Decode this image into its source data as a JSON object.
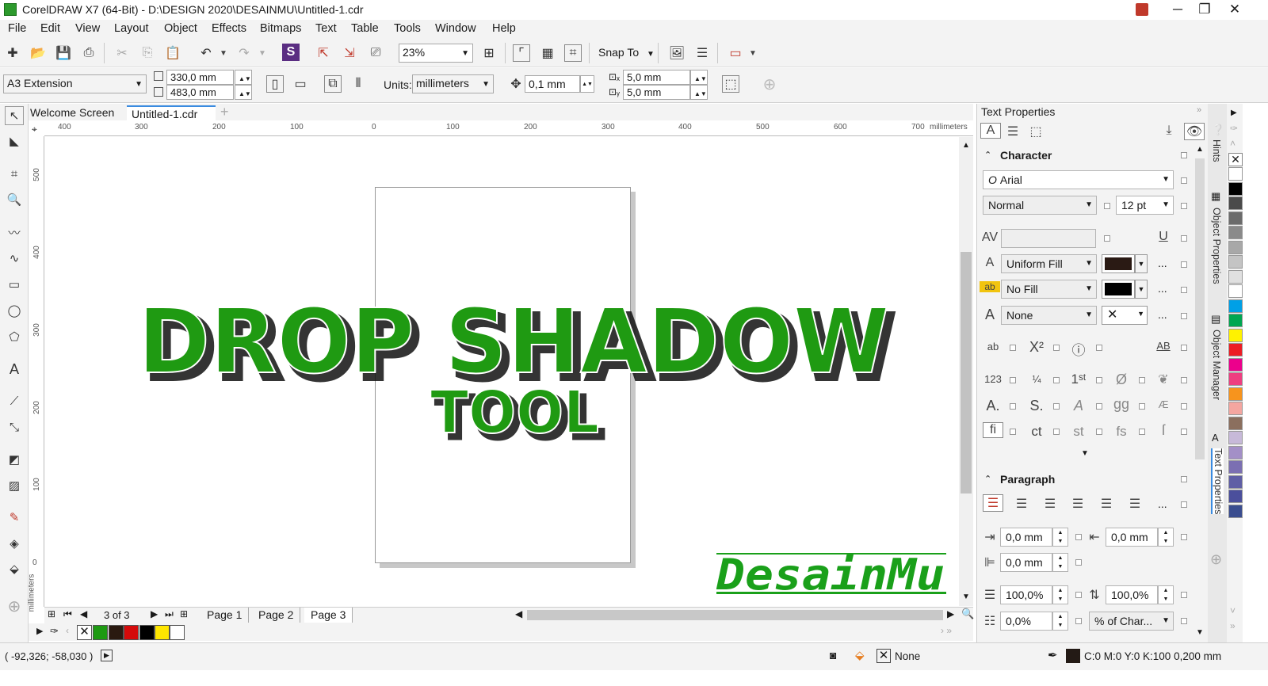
{
  "window": {
    "title": "CorelDRAW X7 (64-Bit) - D:\\DESIGN 2020\\DESAINMU\\Untitled-1.cdr",
    "minimize": "─",
    "restore": "❐",
    "close": "✕"
  },
  "menu": [
    "File",
    "Edit",
    "View",
    "Layout",
    "Object",
    "Effects",
    "Bitmaps",
    "Text",
    "Table",
    "Tools",
    "Window",
    "Help"
  ],
  "toolbar": {
    "zoom": "23%",
    "snap_to": "Snap To"
  },
  "property_bar": {
    "page_size": "A3 Extension",
    "width": "330,0 mm",
    "height": "483,0 mm",
    "units_label": "Units:",
    "units": "millimeters",
    "nudge": "0,1 mm",
    "dup_x": "5,0 mm",
    "dup_y": "5,0 mm"
  },
  "doc_tabs": [
    "Welcome Screen",
    "Untitled-1.cdr"
  ],
  "ruler": {
    "h_ticks": [
      "400",
      "300",
      "200",
      "100",
      "0",
      "100",
      "200",
      "300",
      "400",
      "500",
      "600",
      "700"
    ],
    "unit": "millimeters",
    "v_ticks": [
      "500",
      "400",
      "300",
      "200",
      "100",
      "0"
    ],
    "v_unit": "millimeters"
  },
  "artwork": {
    "line1": "DROP SHADOW",
    "line2": "TOOL",
    "watermark": "DesainMu",
    "text_color": "#1f9a12"
  },
  "page_nav": {
    "counter": "3 of 3",
    "pages": [
      "Page 1",
      "Page 2",
      "Page 3"
    ]
  },
  "status": {
    "coords": "( -92,326; -58,030 )",
    "fill": "None",
    "outline": "C:0 M:0 Y:0 K:100  0,200 mm"
  },
  "text_properties": {
    "title": "Text Properties",
    "character_label": "Character",
    "font": "Arial",
    "style": "Normal",
    "size": "12 pt",
    "fill_type": "Uniform Fill",
    "bg_fill": "No Fill",
    "outline": "None",
    "paragraph_label": "Paragraph",
    "indent_left": "0,0 mm",
    "indent_right": "0,0 mm",
    "indent_first": "0,0 mm",
    "line_spacing": "100,0%",
    "char_spacing": "100,0%",
    "before_para": "0,0%",
    "spacing_unit": "% of Char..."
  },
  "dockers": [
    "Hints",
    "Object Properties",
    "Object Manager",
    "Text Properties"
  ],
  "palette_colors": [
    "#ffffff",
    "#000000",
    "#4a4a4a",
    "#6b6b6b",
    "#8a8a8a",
    "#a8a8a8",
    "#c4c4c4",
    "#e0e0e0",
    "#ffffff",
    "#00a0e6",
    "#00a651",
    "#fff200",
    "#ed1c24",
    "#ec008c",
    "#ee3e80",
    "#f7941d",
    "#f4a6a0",
    "#8b6f5e",
    "#c7b9d9",
    "#a38fc7",
    "#7b6fb2",
    "#5f5ea5",
    "#4b4f9c",
    "#3a4d8f"
  ],
  "doc_palette": [
    "#1d9a12",
    "#2a1a10",
    "#d40a0a",
    "#000000",
    "#ffe600",
    "#ffffff"
  ]
}
